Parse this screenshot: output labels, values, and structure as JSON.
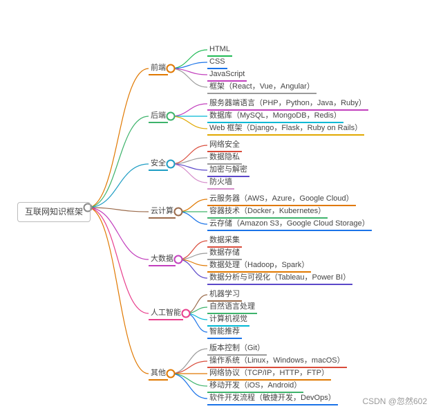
{
  "root": {
    "label": "互联网知识框架"
  },
  "branches": [
    {
      "key": "frontend",
      "label": "前端",
      "color": "#e07800",
      "children": [
        {
          "label": "HTML",
          "color": "#1fba55"
        },
        {
          "label": "CSS",
          "color": "#1a73e8"
        },
        {
          "label": "JavaScript",
          "color": "#c23fbd"
        },
        {
          "label": "框架（React，Vue，Angular）",
          "color": "#9a9a9a"
        }
      ]
    },
    {
      "key": "backend",
      "label": "后端",
      "color": "#3db36b",
      "children": [
        {
          "label": "服务器端语言（PHP，Python，Java，Ruby）",
          "color": "#c23fbd"
        },
        {
          "label": "数据库（MySQL，MongoDB，Redis）",
          "color": "#00b8d4"
        },
        {
          "label": "Web 框架（Django，Flask，Ruby on Rails）",
          "color": "#e0a800"
        }
      ]
    },
    {
      "key": "security",
      "label": "安全",
      "color": "#1e9dc4",
      "children": [
        {
          "label": "网络安全",
          "color": "#d94b3a"
        },
        {
          "label": "数据隐私",
          "color": "#9a9a9a"
        },
        {
          "label": "加密与解密",
          "color": "#5b47c9"
        },
        {
          "label": "防火墙",
          "color": "#d48ac9"
        }
      ]
    },
    {
      "key": "cloud",
      "label": "云计算",
      "color": "#9a6a4a",
      "children": [
        {
          "label": "云服务器（AWS，Azure，Google Cloud）",
          "color": "#e07800"
        },
        {
          "label": "容器技术（Docker，Kubernetes）",
          "color": "#3db36b"
        },
        {
          "label": "云存储（Amazon S3，Google Cloud Storage）",
          "color": "#1a73e8"
        }
      ]
    },
    {
      "key": "bigdata",
      "label": "大数据",
      "color": "#c23fbd",
      "children": [
        {
          "label": "数据采集",
          "color": "#d94b3a"
        },
        {
          "label": "数据存储",
          "color": "#9a9a9a"
        },
        {
          "label": "数据处理（Hadoop，Spark）",
          "color": "#e07800"
        },
        {
          "label": "数据分析与可视化（Tableau，Power BI）",
          "color": "#5b47c9"
        }
      ]
    },
    {
      "key": "ai",
      "label": "人工智能",
      "color": "#e83e8c",
      "children": [
        {
          "label": "机器学习",
          "color": "#9a6a4a"
        },
        {
          "label": "自然语言处理",
          "color": "#3db36b"
        },
        {
          "label": "计算机视觉",
          "color": "#00b8d4"
        },
        {
          "label": "智能推荐",
          "color": "#1a73e8"
        }
      ]
    },
    {
      "key": "other",
      "label": "其他",
      "color": "#e07800",
      "children": [
        {
          "label": "版本控制（Git）",
          "color": "#9a9a9a"
        },
        {
          "label": "操作系统（Linux，Windows，macOS）",
          "color": "#d94b3a"
        },
        {
          "label": "网络协议（TCP/IP，HTTP，FTP）",
          "color": "#e07800"
        },
        {
          "label": "移动开发（iOS，Android）",
          "color": "#3db36b"
        },
        {
          "label": "软件开发流程（敏捷开发，DevOps）",
          "color": "#1a73e8"
        }
      ]
    }
  ],
  "watermark": "CSDN @忽然602",
  "chart_data": {
    "type": "table",
    "title": "互联网知识框架",
    "series": [
      {
        "name": "前端",
        "values": [
          "HTML",
          "CSS",
          "JavaScript",
          "框架（React，Vue，Angular）"
        ]
      },
      {
        "name": "后端",
        "values": [
          "服务器端语言（PHP，Python，Java，Ruby）",
          "数据库（MySQL，MongoDB，Redis）",
          "Web 框架（Django，Flask，Ruby on Rails）"
        ]
      },
      {
        "name": "安全",
        "values": [
          "网络安全",
          "数据隐私",
          "加密与解密",
          "防火墙"
        ]
      },
      {
        "name": "云计算",
        "values": [
          "云服务器（AWS，Azure，Google Cloud）",
          "容器技术（Docker，Kubernetes）",
          "云存储（Amazon S3，Google Cloud Storage）"
        ]
      },
      {
        "name": "大数据",
        "values": [
          "数据采集",
          "数据存储",
          "数据处理（Hadoop，Spark）",
          "数据分析与可视化（Tableau，Power BI）"
        ]
      },
      {
        "name": "人工智能",
        "values": [
          "机器学习",
          "自然语言处理",
          "计算机视觉",
          "智能推荐"
        ]
      },
      {
        "name": "其他",
        "values": [
          "版本控制（Git）",
          "操作系统（Linux，Windows，macOS）",
          "网络协议（TCP/IP，HTTP，FTP）",
          "移动开发（iOS，Android）",
          "软件开发流程（敏捷开发，DevOps）"
        ]
      }
    ]
  }
}
